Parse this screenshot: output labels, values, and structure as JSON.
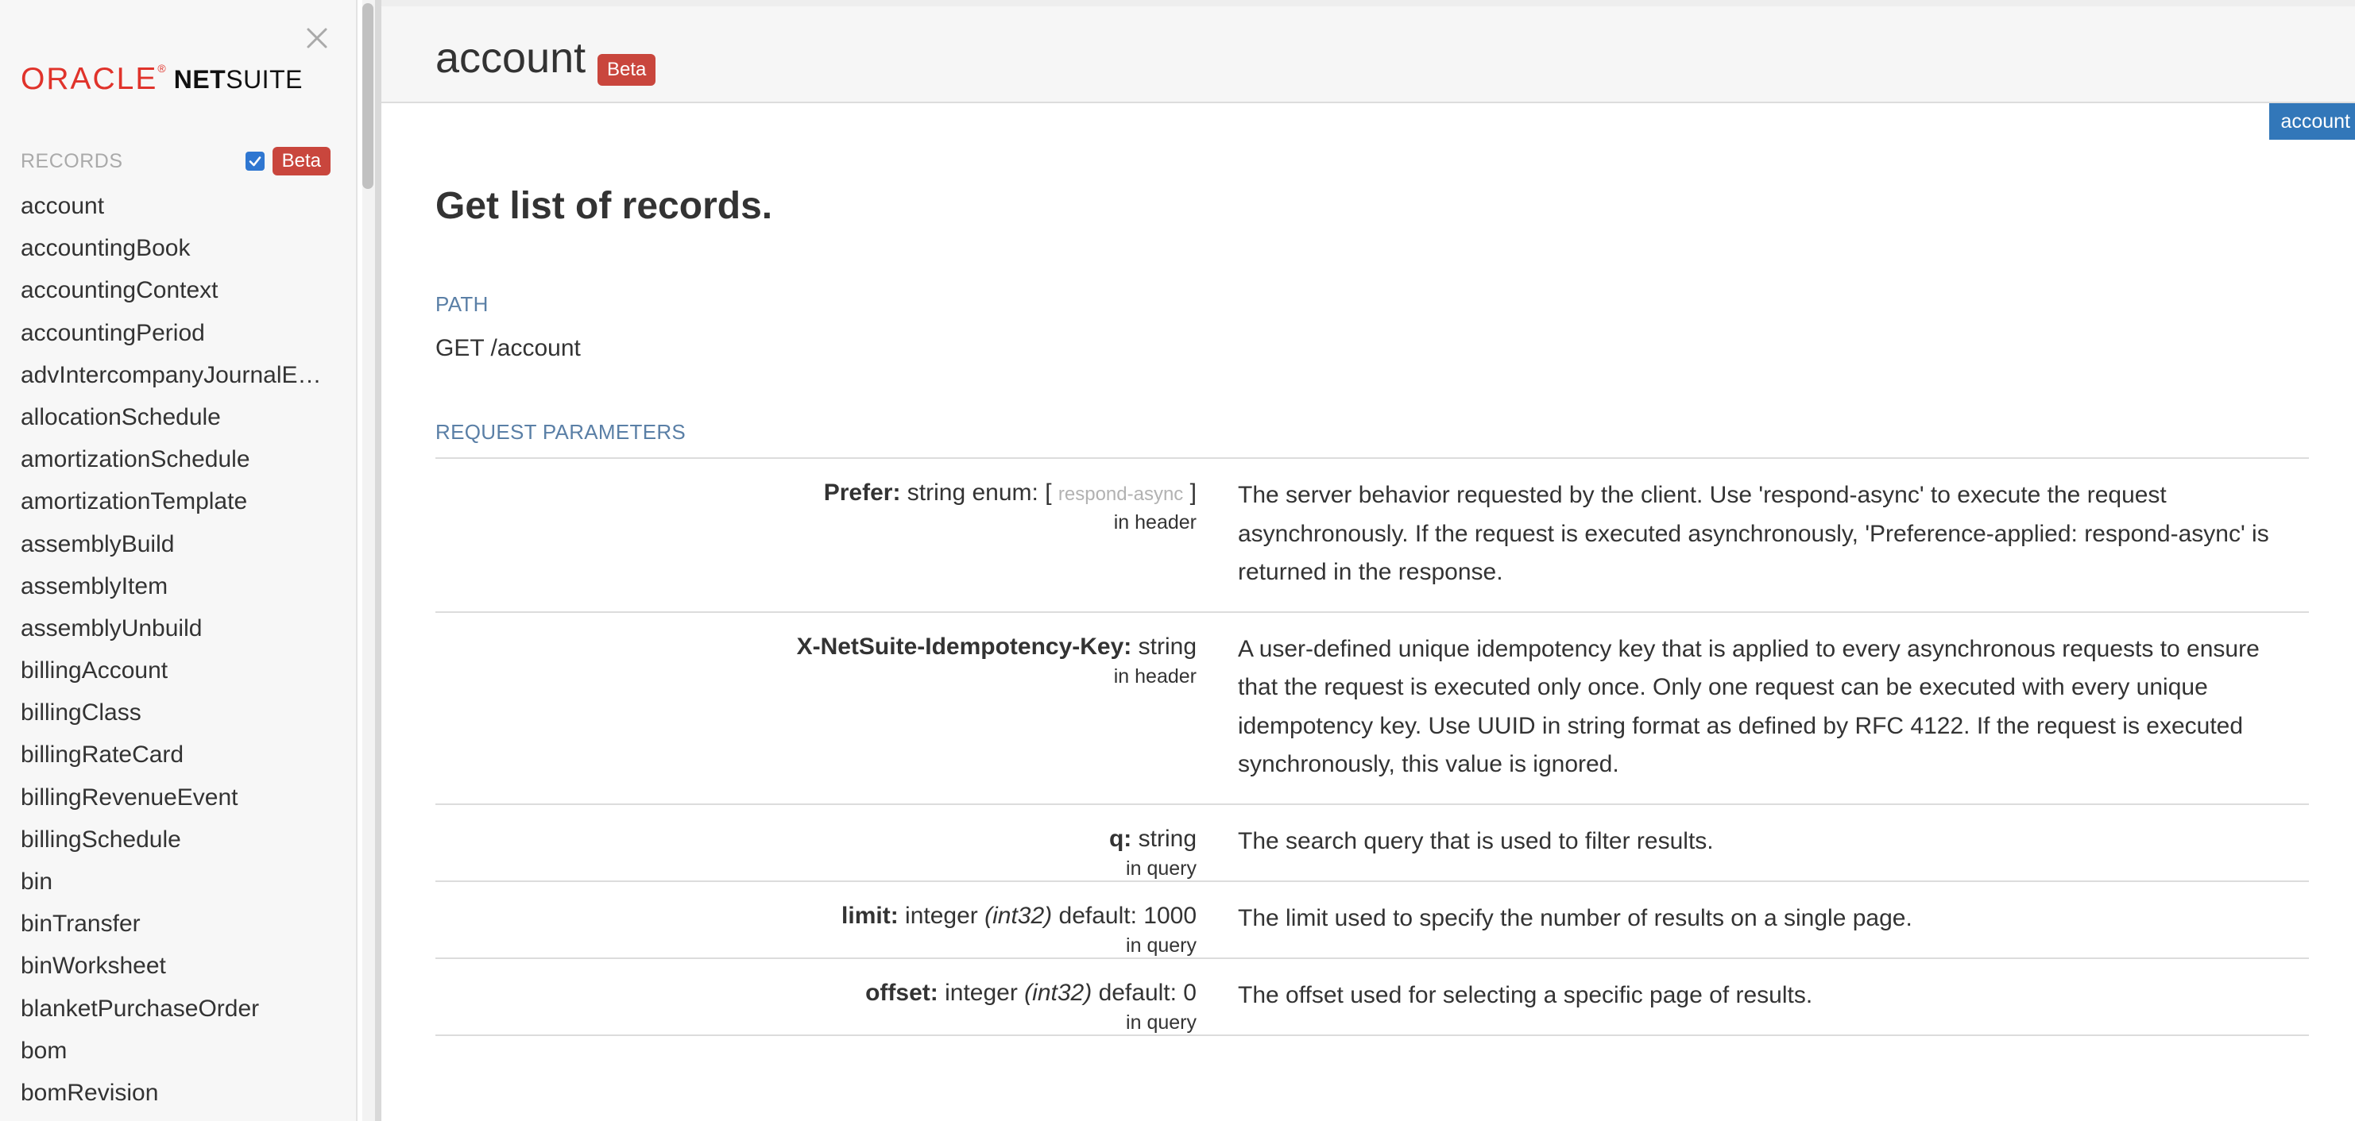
{
  "sidebar": {
    "logo": {
      "oracle": "ORACLE",
      "registered": "®",
      "netsuite_bold": "NET",
      "netsuite_rest": "SUITE"
    },
    "records_label": "RECORDS",
    "beta_checkbox_checked": true,
    "beta_badge": "Beta",
    "items": [
      "account",
      "accountingBook",
      "accountingContext",
      "accountingPeriod",
      "advIntercompanyJournalE…",
      "allocationSchedule",
      "amortizationSchedule",
      "amortizationTemplate",
      "assemblyBuild",
      "assemblyItem",
      "assemblyUnbuild",
      "billingAccount",
      "billingClass",
      "billingRateCard",
      "billingRevenueEvent",
      "billingSchedule",
      "bin",
      "binTransfer",
      "binWorksheet",
      "blanketPurchaseOrder",
      "bom",
      "bomRevision"
    ]
  },
  "header": {
    "title": "account",
    "badge": "Beta"
  },
  "tag_label": "account",
  "operation": {
    "summary": "Get list of records.",
    "path_label": "PATH",
    "path": "GET /account",
    "request_params_label": "REQUEST PARAMETERS"
  },
  "params": [
    {
      "name": "Prefer:",
      "type": "string enum: [",
      "enum": "respond-async",
      "type_end": "]",
      "location": "in header",
      "description": "The server behavior requested by the client. Use 'respond-async' to execute the request asynchronously. If the request is executed asynchronously, 'Preference-applied: respond-async' is returned in the response."
    },
    {
      "name": "X-NetSuite-Idempotency-Key:",
      "type": "string",
      "location": "in header",
      "description": "A user-defined unique idempotency key that is applied to every asynchronous requests to ensure that the request is executed only once. Only one request can be executed with every unique idempotency key. Use UUID in string format as defined by RFC 4122. If the request is executed synchronously, this value is ignored."
    },
    {
      "name": "q:",
      "type": "string",
      "location": "in query",
      "description": "The search query that is used to filter results."
    },
    {
      "name": "limit:",
      "type": "integer",
      "format": "(int32)",
      "default_text": "default: 1000",
      "location": "in query",
      "description": "The limit used to specify the number of results on a single page."
    },
    {
      "name": "offset:",
      "type": "integer",
      "format": "(int32)",
      "default_text": "default: 0",
      "location": "in query",
      "description": "The offset used for selecting a specific page of results."
    }
  ],
  "colors": {
    "oracle_red": "#e0332b",
    "beta_badge": "#c9463d",
    "tag_blue": "#3277b9",
    "section_label": "#5a7fa6",
    "checkbox_blue": "#2f77d1"
  }
}
